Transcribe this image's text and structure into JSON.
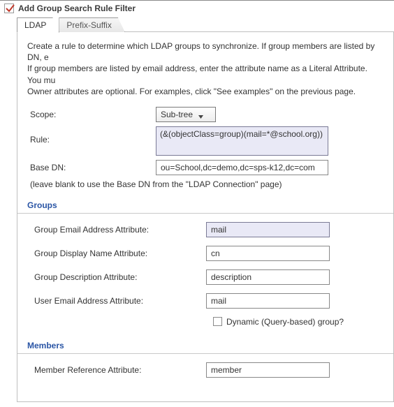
{
  "title": "Add Group Search Rule Filter",
  "tabs": [
    {
      "label": "LDAP",
      "active": true
    },
    {
      "label": "Prefix-Suffix",
      "active": false
    }
  ],
  "intro_line1": "Create a rule to determine which LDAP groups to synchronize. If group members are listed by DN, e",
  "intro_line2": "If group members are listed by email address, enter the attribute name as a Literal Attribute. You mu",
  "intro_line3": "Owner attributes are optional. For examples, click \"See examples\" on the previous page.",
  "labels": {
    "scope": "Scope:",
    "rule": "Rule:",
    "base_dn": "Base DN:"
  },
  "scope_selected": "Sub-tree",
  "rule_value": "(&(objectClass=group)(mail=*@school.org))",
  "base_dn_value": "ou=School,dc=demo,dc=sps-k12,dc=com",
  "base_dn_note": "(leave blank to use the Base DN from the \"LDAP Connection\" page)",
  "groups_header": "Groups",
  "members_header": "Members",
  "groups": {
    "email_label": "Group Email Address Attribute:",
    "email_value": "mail",
    "display_label": "Group Display Name Attribute:",
    "display_value": "cn",
    "desc_label": "Group Description Attribute:",
    "desc_value": "description",
    "user_email_label": "User Email Address Attribute:",
    "user_email_value": "mail",
    "dyn_label": "Dynamic (Query-based) group?"
  },
  "members": {
    "ref_label": "Member Reference Attribute:",
    "ref_value": "member"
  }
}
